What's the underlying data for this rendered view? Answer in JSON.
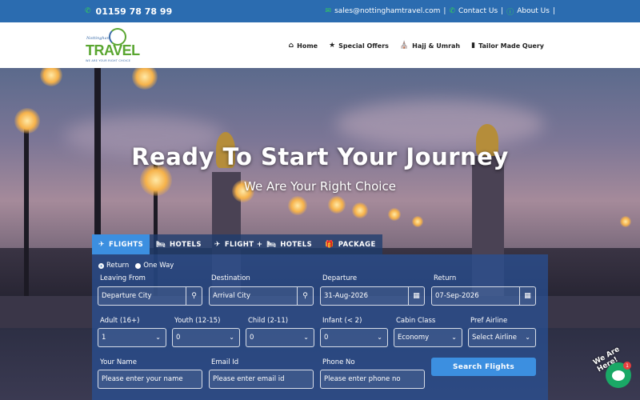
{
  "topbar": {
    "phone": "01159 78 78 99",
    "email": "sales@nottinghamtravel.com",
    "contact_label": "Contact Us",
    "about_label": "About Us",
    "separator": "|"
  },
  "logo": {
    "small_text": "Nottingham",
    "big_text": "TRAVEL",
    "tagline": "WE ARE YOUR RIGHT CHOICE"
  },
  "nav": [
    {
      "label": "Home",
      "icon": "home-icon"
    },
    {
      "label": "Special Offers",
      "icon": "star-icon"
    },
    {
      "label": "Hajj & Umrah",
      "icon": "mosque-icon"
    },
    {
      "label": "Tailor Made Query",
      "icon": "mobile-icon"
    }
  ],
  "hero": {
    "title": "Ready To Start Your Journey",
    "subtitle": "We Are Your Right Choice"
  },
  "tabs": [
    {
      "label": "FLIGHTS",
      "icon": "plane-icon",
      "active": true
    },
    {
      "label": "HOTELS",
      "icon": "bed-icon",
      "active": false
    },
    {
      "label": "FLIGHT + ",
      "label2": "HOTELS",
      "icon": "plane-icon",
      "active": false
    },
    {
      "label": "PACKAGE",
      "icon": "gift-icon",
      "active": false
    }
  ],
  "form": {
    "trip_type": [
      "Return",
      "One Way"
    ],
    "selected_trip": "Return",
    "leaving_from": {
      "label": "Leaving From",
      "placeholder": "Departure City"
    },
    "destination": {
      "label": "Destination",
      "placeholder": "Arrival City"
    },
    "departure": {
      "label": "Departure",
      "value": "31-Aug-2026"
    },
    "return_date": {
      "label": "Return",
      "value": "07-Sep-2026"
    },
    "adult": {
      "label": "Adult (16+)",
      "value": "1"
    },
    "youth": {
      "label": "Youth (12-15)",
      "value": "0"
    },
    "child": {
      "label": "Child (2-11)",
      "value": "0"
    },
    "infant": {
      "label": "Infant (< 2)",
      "value": "0"
    },
    "cabin": {
      "label": "Cabin Class",
      "value": "Economy"
    },
    "airline": {
      "label": "Pref Airline",
      "value": "Select Airline"
    },
    "name": {
      "label": "Your Name",
      "placeholder": "Please enter your name"
    },
    "email": {
      "label": "Email Id",
      "placeholder": "Please enter email id"
    },
    "phone": {
      "label": "Phone No",
      "placeholder": "Please enter phone no"
    },
    "search_label": "Search Flights"
  },
  "chat": {
    "badge": "1",
    "help_text": "We Are Here!"
  },
  "colors": {
    "topbar": "#2b6cb0",
    "accent": "#3c8fe0",
    "logo_green": "#5aa631",
    "chat_green": "#1aa866"
  }
}
